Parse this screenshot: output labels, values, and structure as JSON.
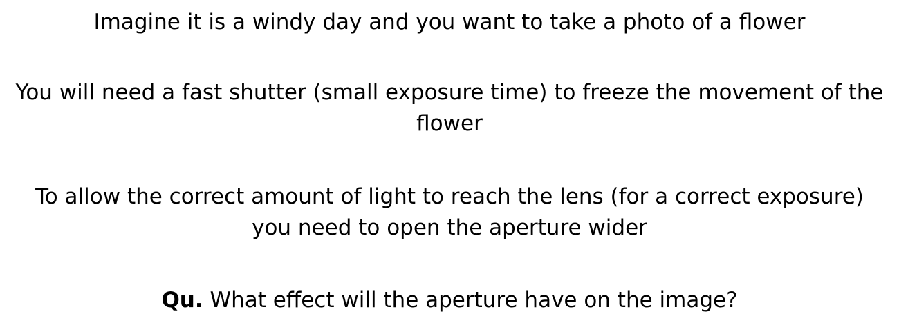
{
  "slide": {
    "paragraph_1": "Imagine it is a windy day and you want to take a photo of a flower",
    "paragraph_2": "You will need a fast shutter (small exposure time) to freeze the movement of the flower",
    "paragraph_3": "To allow the correct amount of light to reach the lens (for a correct exposure) you need to open the aperture wider",
    "question": {
      "label": "Qu.",
      "text": "What effect will the aperture have on the image?"
    }
  }
}
